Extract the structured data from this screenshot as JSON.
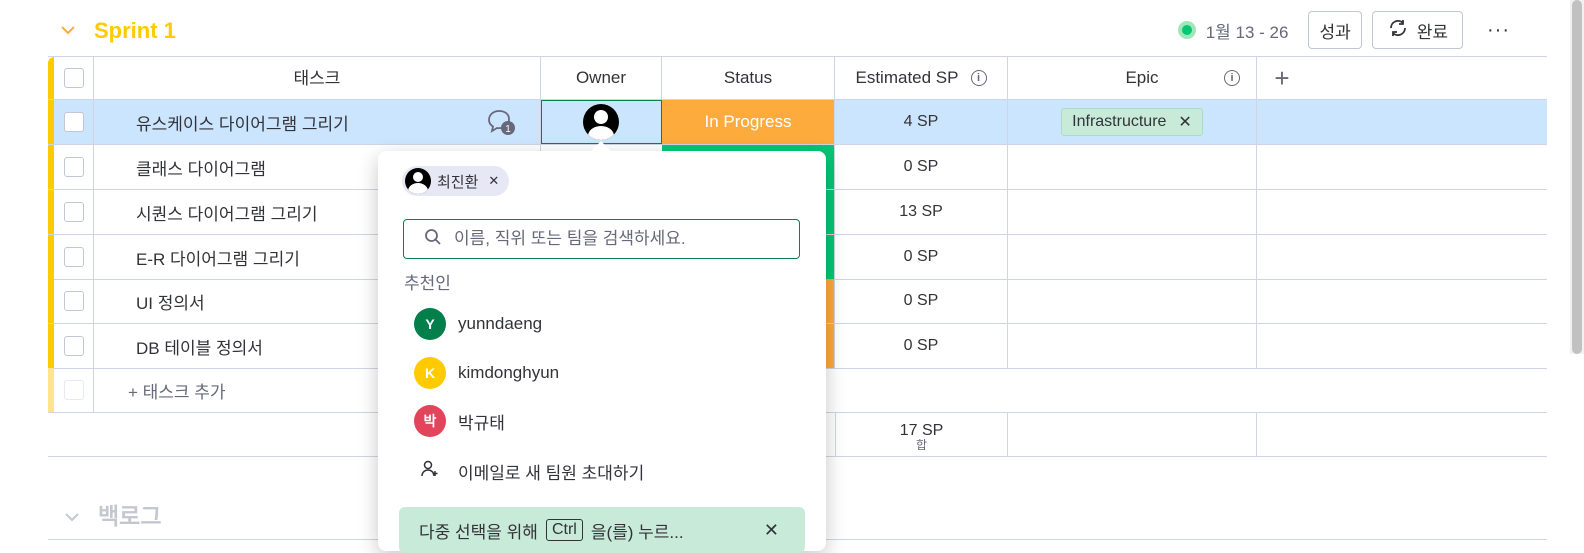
{
  "sprint": {
    "title": "Sprint 1",
    "date_range": "1월 13 - 26",
    "perf_label": "성과",
    "complete_label": "완료",
    "more_label": "···"
  },
  "columns": {
    "task": "태스크",
    "owner": "Owner",
    "status": "Status",
    "estimated": "Estimated SP",
    "epic": "Epic",
    "add": "+"
  },
  "rows": [
    {
      "task": "유스케이스 다이어그램 그리기",
      "status": "In Progress",
      "sp": "4 SP",
      "epic": "Infrastructure",
      "comments": "1"
    },
    {
      "task": "클래스 다이어그램",
      "sp": "0 SP"
    },
    {
      "task": "시퀀스 다이어그램 그리기",
      "sp": "13 SP"
    },
    {
      "task": "E-R 다이어그램 그리기",
      "sp": "0 SP"
    },
    {
      "task": "UI 정의서",
      "sp": "0 SP"
    },
    {
      "task": "DB 테이블 정의서",
      "sp": "0 SP"
    }
  ],
  "add_task_label": "+ 태스크 추가",
  "summary": {
    "sp_total": "17 SP",
    "sp_caption": "합"
  },
  "popup": {
    "selected_chip": "최진환",
    "search_placeholder": "이름, 직위 또는 팀을 검색하세요.",
    "section_label": "추천인",
    "people": [
      {
        "initial": "Y",
        "name": "yunndaeng",
        "color": "#037f4c"
      },
      {
        "initial": "K",
        "name": "kimdonghyun",
        "color": "#ffcb00"
      },
      {
        "initial": "박",
        "name": "박규태",
        "color": "#e2445c"
      }
    ],
    "invite_label": "이메일로 새 팀원 초대하기",
    "hint_prefix": "다중 선택을 위해",
    "hint_key": "Ctrl",
    "hint_suffix": "을(를) 누르..."
  },
  "backlog": {
    "title": "백로그"
  }
}
